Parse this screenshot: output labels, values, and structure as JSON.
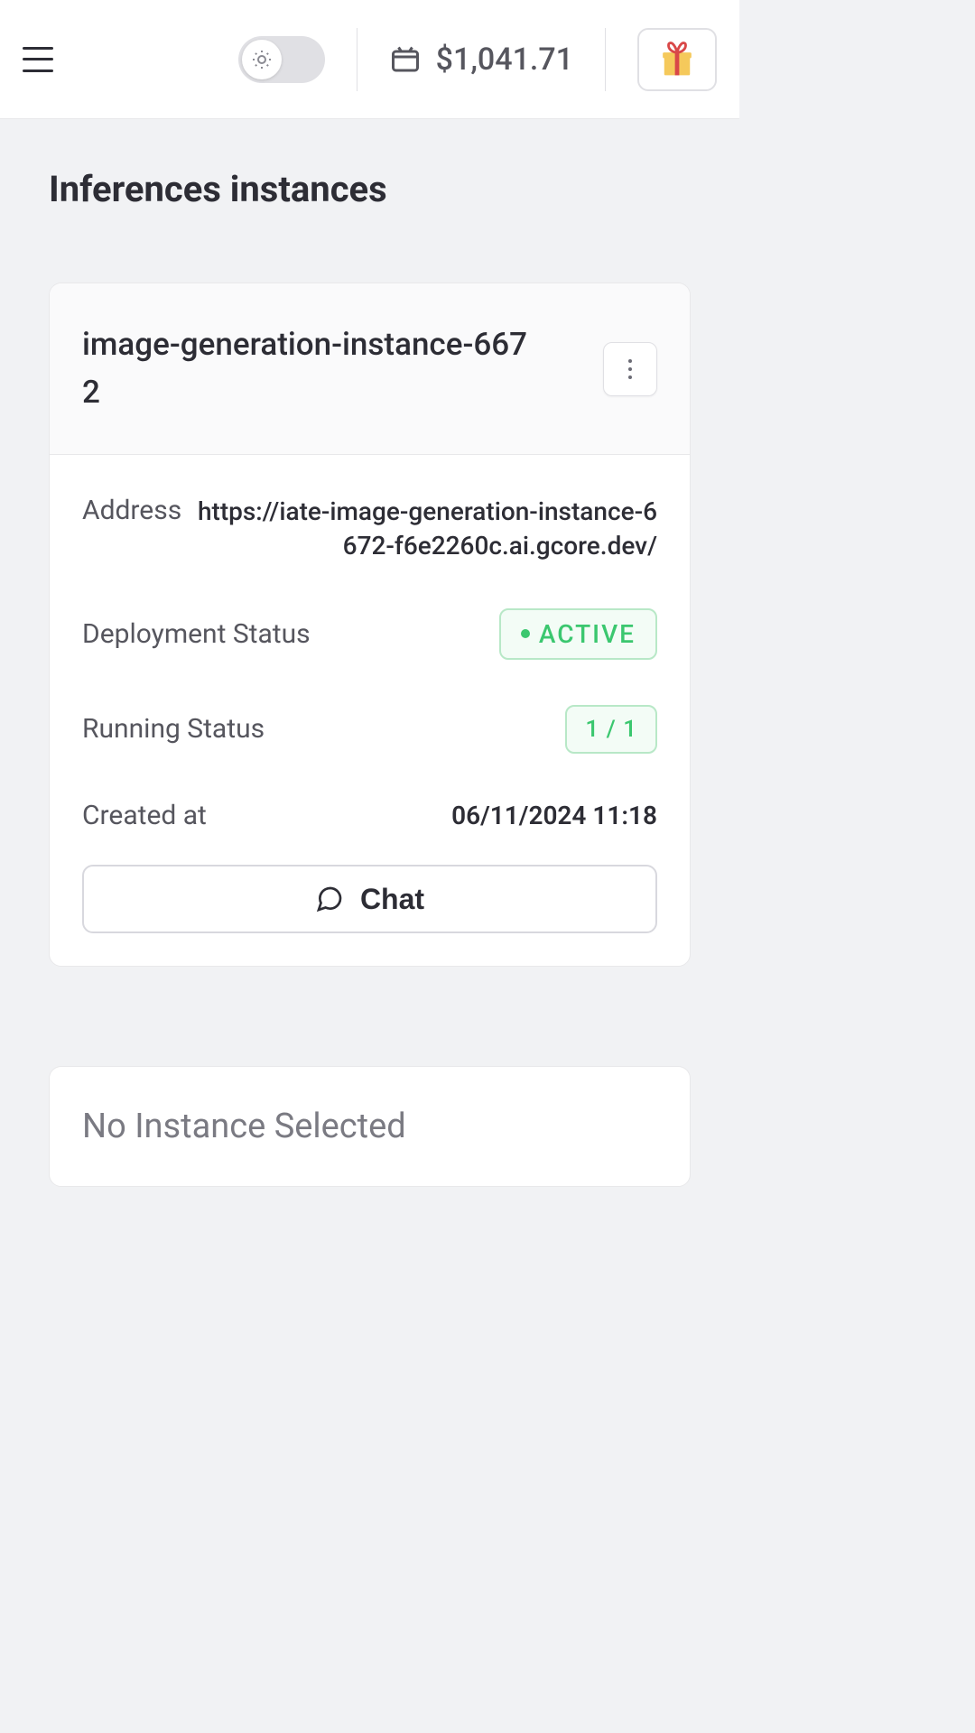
{
  "header": {
    "balance": "$1,041.71"
  },
  "page": {
    "title": "Inferences instances"
  },
  "instance": {
    "name": "image-generation-instance-6672",
    "fields": {
      "address_label": "Address",
      "address_value": "https://iate-image-generation-instance-6672-f6e2260c.ai.gcore.dev/",
      "deployment_label": "Deployment Status",
      "deployment_value": "ACTIVE",
      "running_label": "Running Status",
      "running_value": "1 / 1",
      "created_label": "Created at",
      "created_value": "06/11/2024 11:18"
    },
    "chat_button": "Chat"
  },
  "selection": {
    "empty": "No Instance Selected"
  }
}
